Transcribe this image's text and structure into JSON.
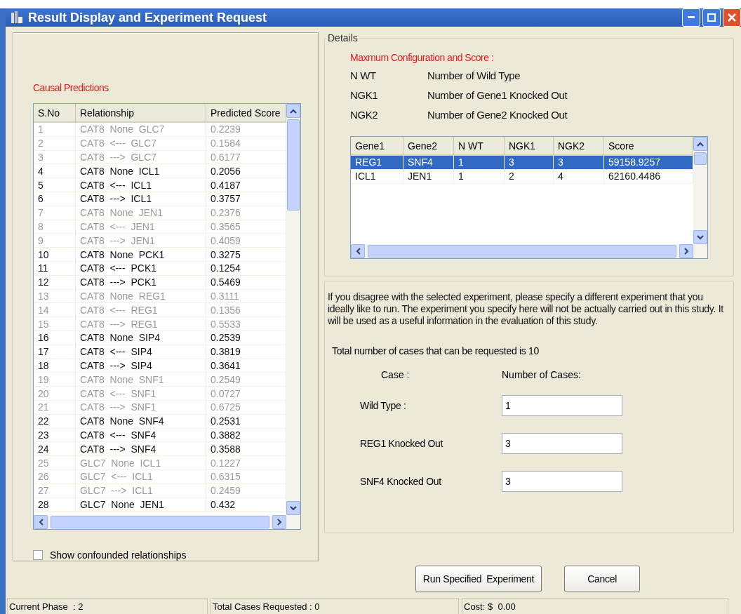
{
  "window": {
    "title": "Result Display and Experiment Request"
  },
  "causal_predictions": {
    "title": "Causal Predictions",
    "columns": [
      "S.No",
      "Relationship",
      "Predicted Score"
    ],
    "rows": [
      {
        "no": "1",
        "relationship": "CAT8  None  GLC7",
        "score": "0.2239",
        "dimmed": true
      },
      {
        "no": "2",
        "relationship": "CAT8  <---  GLC7",
        "score": "0.1584",
        "dimmed": true
      },
      {
        "no": "3",
        "relationship": "CAT8  --->  GLC7",
        "score": "0.6177",
        "dimmed": true
      },
      {
        "no": "4",
        "relationship": "CAT8  None  ICL1",
        "score": "0.2056",
        "dimmed": false
      },
      {
        "no": "5",
        "relationship": "CAT8  <---  ICL1",
        "score": "0.4187",
        "dimmed": false
      },
      {
        "no": "6",
        "relationship": "CAT8  --->  ICL1",
        "score": "0.3757",
        "dimmed": false
      },
      {
        "no": "7",
        "relationship": "CAT8  None  JEN1",
        "score": "0.2376",
        "dimmed": true
      },
      {
        "no": "8",
        "relationship": "CAT8  <---  JEN1",
        "score": "0.3565",
        "dimmed": true
      },
      {
        "no": "9",
        "relationship": "CAT8  --->  JEN1",
        "score": "0.4059",
        "dimmed": true
      },
      {
        "no": "10",
        "relationship": "CAT8  None  PCK1",
        "score": "0.3275",
        "dimmed": false
      },
      {
        "no": "11",
        "relationship": "CAT8  <---  PCK1",
        "score": "0.1254",
        "dimmed": false
      },
      {
        "no": "12",
        "relationship": "CAT8  --->  PCK1",
        "score": "0.5469",
        "dimmed": false
      },
      {
        "no": "13",
        "relationship": "CAT8  None  REG1",
        "score": "0.3111",
        "dimmed": true
      },
      {
        "no": "14",
        "relationship": "CAT8  <---  REG1",
        "score": "0.1356",
        "dimmed": true
      },
      {
        "no": "15",
        "relationship": "CAT8  --->  REG1",
        "score": "0.5533",
        "dimmed": true
      },
      {
        "no": "16",
        "relationship": "CAT8  None  SIP4",
        "score": "0.2539",
        "dimmed": false
      },
      {
        "no": "17",
        "relationship": "CAT8  <---  SIP4",
        "score": "0.3819",
        "dimmed": false
      },
      {
        "no": "18",
        "relationship": "CAT8  --->  SIP4",
        "score": "0.3641",
        "dimmed": false
      },
      {
        "no": "19",
        "relationship": "CAT8  None  SNF1",
        "score": "0.2549",
        "dimmed": true
      },
      {
        "no": "20",
        "relationship": "CAT8  <---  SNF1",
        "score": "0.0727",
        "dimmed": true
      },
      {
        "no": "21",
        "relationship": "CAT8  --->  SNF1",
        "score": "0.6725",
        "dimmed": true
      },
      {
        "no": "22",
        "relationship": "CAT8  None  SNF4",
        "score": "0.2531",
        "dimmed": false
      },
      {
        "no": "23",
        "relationship": "CAT8  <---  SNF4",
        "score": "0.3882",
        "dimmed": false
      },
      {
        "no": "24",
        "relationship": "CAT8  --->  SNF4",
        "score": "0.3588",
        "dimmed": false
      },
      {
        "no": "25",
        "relationship": "GLC7  None  ICL1",
        "score": "0.1227",
        "dimmed": true
      },
      {
        "no": "26",
        "relationship": "GLC7  <---  ICL1",
        "score": "0.6315",
        "dimmed": true
      },
      {
        "no": "27",
        "relationship": "GLC7  --->  ICL1",
        "score": "0.2459",
        "dimmed": true
      },
      {
        "no": "28",
        "relationship": "GLC7  None  JEN1",
        "score": "0.432",
        "dimmed": false
      }
    ],
    "show_confounded": {
      "label": "Show confounded relationships",
      "checked": false
    }
  },
  "details": {
    "title": "Details",
    "heading": "Maxmum Configuration  and Score :",
    "legend": [
      {
        "abbr": "N WT",
        "meaning": "Number of Wild Type"
      },
      {
        "abbr": "NGK1",
        "meaning": "Number of Gene1 Knocked Out"
      },
      {
        "abbr": "NGK2",
        "meaning": "Number of Gene2 Knocked Out"
      }
    ],
    "columns": [
      "Gene1",
      "Gene2",
      "N WT",
      "NGK1",
      "NGK2",
      "Score"
    ],
    "rows": [
      {
        "cells": [
          "REG1",
          "SNF4",
          "1",
          "3",
          "3",
          "59158.9257"
        ],
        "selected": true
      },
      {
        "cells": [
          "ICL1",
          "JEN1",
          "1",
          "2",
          "4",
          "62160.4486"
        ],
        "selected": false
      }
    ]
  },
  "request": {
    "instructions": "If you disagree with the selected experiment, please specify a different experiment that you ideally like to run. The experiment you specify here will not be actually carried out in this study. It will be used as a useful information in the evaluation of this study.",
    "total_note": "Total number of cases that can be requested is 10",
    "case_header": "Case :",
    "count_header": "Number of Cases:",
    "cases": [
      {
        "label": "Wild Type :",
        "value": "1"
      },
      {
        "label": "REG1 Knocked Out",
        "value": "3"
      },
      {
        "label": "SNF4 Knocked Out",
        "value": "3"
      }
    ]
  },
  "buttons": [
    "Run Specified  Experiment",
    "Cancel"
  ],
  "status_bar": [
    "Current Phase  : 2",
    "Total Cases Requested : 0",
    "Cost: $  0.00"
  ]
}
